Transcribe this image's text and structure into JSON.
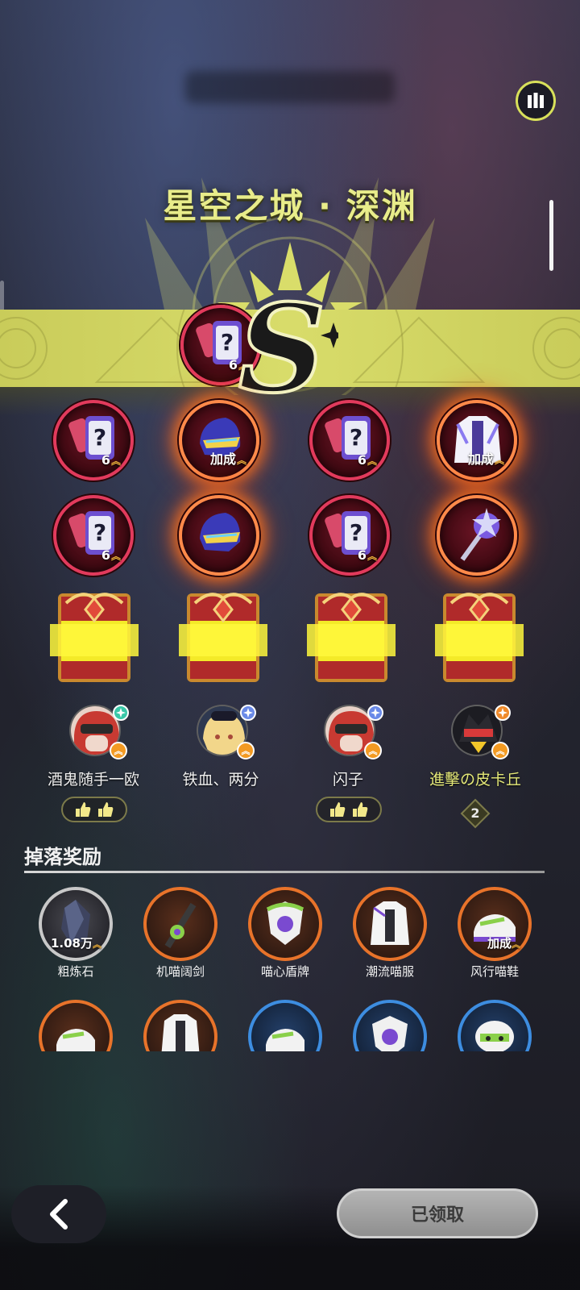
{
  "header": {
    "title": "星空之城 · 深渊",
    "grade": "S"
  },
  "icons": {
    "stats": "bar-chart-icon",
    "back": "chevron-left-icon",
    "like": "thumbs-up-icon",
    "up_arrow": "double-chevron-up-icon"
  },
  "colors": {
    "accent_yellow": "#d8dc6a",
    "item_ring_red": "#e23a5c",
    "glow_orange": "#ff8a4a",
    "rarity_orange": "#e8732a",
    "rarity_blue": "#3d8de0",
    "rarity_grey": "#c8c8c8"
  },
  "featured_item": {
    "count": "6"
  },
  "reward_items": [
    {
      "name": "mystery-gear-bag",
      "label": "6",
      "glow": false
    },
    {
      "name": "helmet",
      "label": "加成",
      "glow": true
    },
    {
      "name": "mystery-gear-bag",
      "label": "6",
      "glow": false
    },
    {
      "name": "jacket",
      "label": "加成",
      "glow": true
    },
    {
      "name": "mystery-gear-bag",
      "label": "6",
      "glow": false
    },
    {
      "name": "helmet",
      "label": "",
      "glow": true
    },
    {
      "name": "mystery-gear-bag",
      "label": "6",
      "glow": false
    },
    {
      "name": "mace",
      "label": "",
      "glow": true
    }
  ],
  "players": [
    {
      "name": "酒鬼随手一欧",
      "likes_icons": 2,
      "likes_count": ""
    },
    {
      "name": "铁血、两分",
      "likes_icons": 0,
      "likes_count": ""
    },
    {
      "name": "闪子",
      "likes_icons": 2,
      "likes_count": ""
    },
    {
      "name": "進擊の皮卡丘",
      "likes_icons": 0,
      "likes_count": "2"
    }
  ],
  "drops": {
    "title": "掉落奖励",
    "items": [
      {
        "label": "粗炼石",
        "value": "1.08万",
        "rarity": "grey"
      },
      {
        "label": "机喵阔剑",
        "value": "",
        "rarity": "orange"
      },
      {
        "label": "喵心盾牌",
        "value": "",
        "rarity": "orange"
      },
      {
        "label": "潮流喵服",
        "value": "",
        "rarity": "orange"
      },
      {
        "label": "风行喵鞋",
        "value": "加成",
        "rarity": "orange"
      }
    ]
  },
  "footer": {
    "claimed_label": "已领取"
  }
}
